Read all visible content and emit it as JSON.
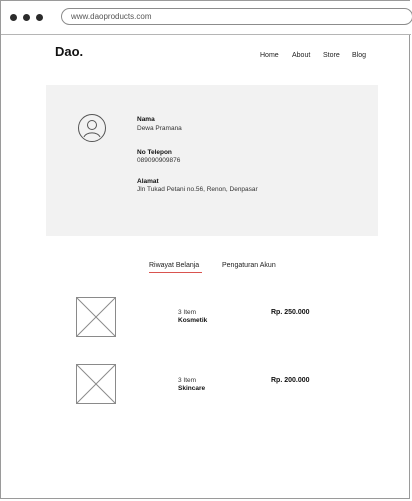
{
  "browser": {
    "url": "www.daoproducts.com"
  },
  "header": {
    "logo": "Dao.",
    "nav": [
      "Home",
      "About",
      "Store",
      "Blog"
    ]
  },
  "profile": {
    "name_label": "Nama",
    "name_value": "Dewa Pramana",
    "phone_label": "No Telepon",
    "phone_value": "089090909876",
    "address_label": "Alamat",
    "address_value": "Jln Tukad Petani no.56, Renon, Denpasar"
  },
  "tabs": [
    {
      "label": "Riwayat Belanja",
      "active": true
    },
    {
      "label": "Pengaturan Akun",
      "active": false
    }
  ],
  "orders": [
    {
      "qty": "3 Item",
      "category": "Kosmetik",
      "price": "Rp. 250.000"
    },
    {
      "qty": "3 Item",
      "category": "Skincare",
      "price": "Rp. 200.000"
    }
  ],
  "colors": {
    "card_bg": "#f2f2f2",
    "active_tab_underline": "#d9534f"
  }
}
